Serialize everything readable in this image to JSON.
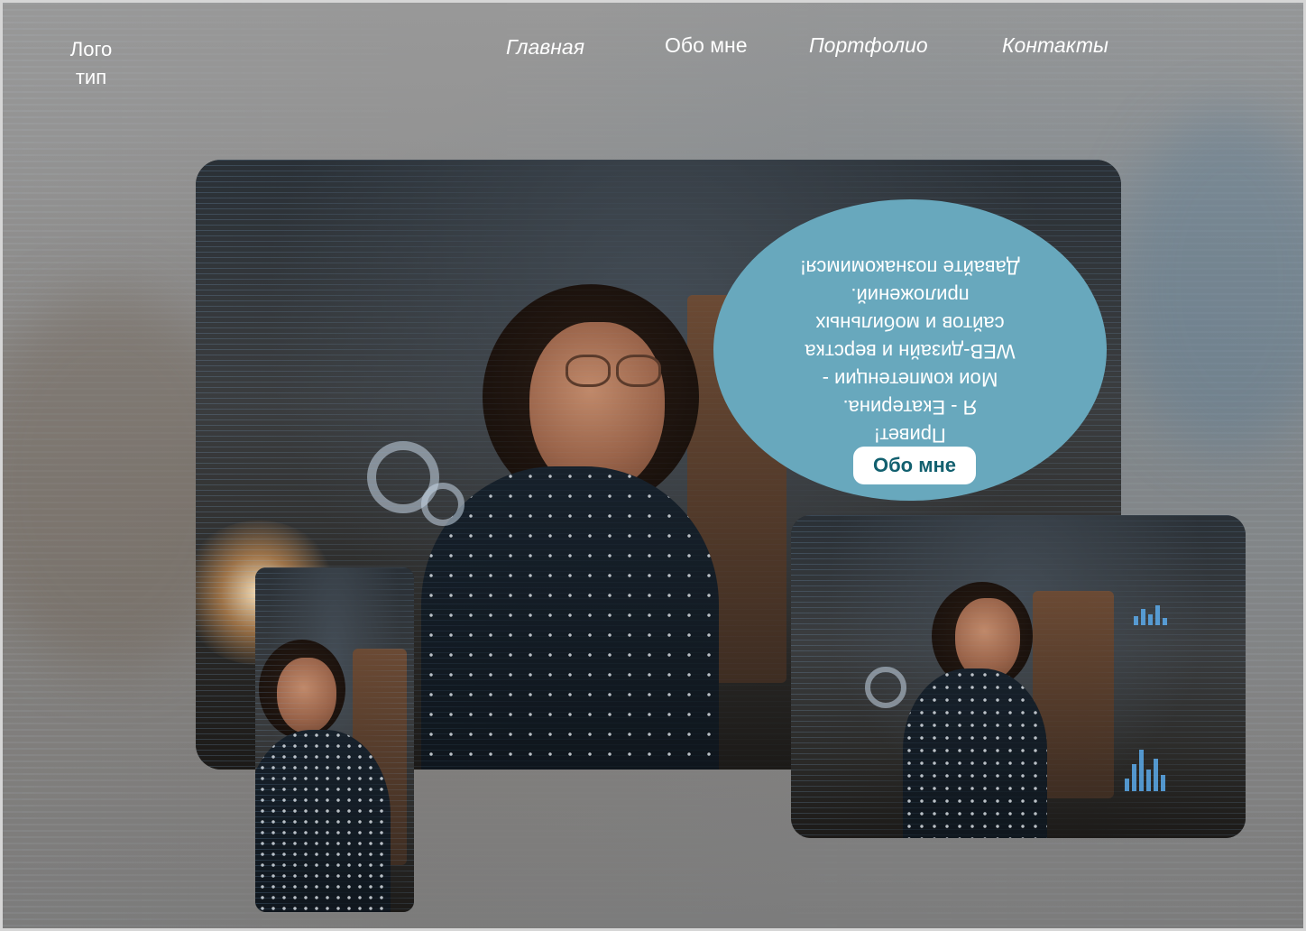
{
  "header": {
    "logo": "Лого\nтип",
    "nav": [
      {
        "label": "Главная"
      },
      {
        "label": "Обо мне"
      },
      {
        "label": "Портфолио"
      },
      {
        "label": "Контакты"
      }
    ]
  },
  "hero": {
    "bubble_text": "Привет!\nЯ - Екатерина.\nМои компетенции -\nWEB-дизайн и верстка\nсайтов и мобильных\nприложений.\nДавайте познакомимся!",
    "bubble_text_rotated": true,
    "about_button": "Обо мне"
  },
  "colors": {
    "bubble": "#68a8bd",
    "button_text": "#12606f"
  }
}
